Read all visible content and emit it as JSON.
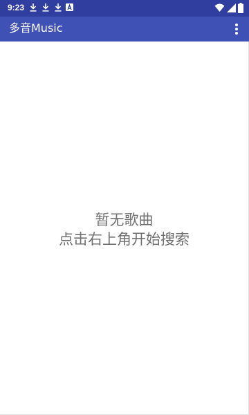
{
  "status_bar": {
    "time": "9:23",
    "icons": [
      "download-icon",
      "download-icon",
      "download-icon",
      "font-a-icon",
      "wifi-icon",
      "cellular-signal-icon",
      "battery-icon"
    ]
  },
  "app_bar": {
    "title": "多音Music",
    "menu_icon": "more-vert-icon"
  },
  "main": {
    "empty_title": "暂无歌曲",
    "empty_hint": "点击右上角开始搜索"
  },
  "colors": {
    "status_bar_bg": "#303f9f",
    "app_bar_bg": "#3f51b5",
    "empty_text": "#707070"
  }
}
